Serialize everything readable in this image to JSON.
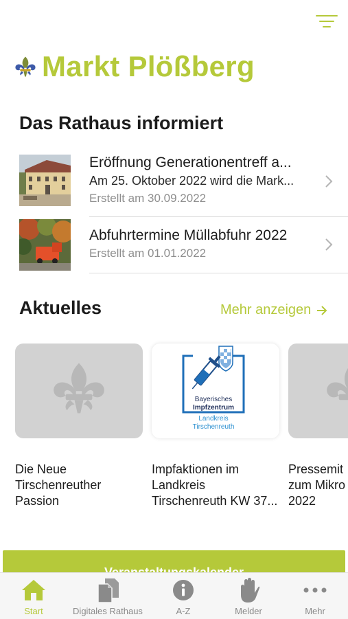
{
  "header": {
    "app_title": "Markt Plößberg",
    "filter_icon": "filter-icon",
    "accent_color": "#b5c93a"
  },
  "rathaus": {
    "title": "Das Rathaus informiert",
    "items": [
      {
        "title": "Eröffnung Generationentreff a...",
        "subtitle": "Am 25. Oktober 2022 wird die Mark...",
        "date": "Erstellt am 30.09.2022"
      },
      {
        "title": "Abfuhrtermine Müllabfuhr 2022",
        "date": "Erstellt am 01.01.2022"
      }
    ]
  },
  "aktuelles": {
    "title": "Aktuelles",
    "more_label": "Mehr anzeigen",
    "cards": [
      {
        "title": "Die Neue Tirschenreuther Passion"
      },
      {
        "title": "Impfaktionen im Landkreis Tirschenreuth KW 37...",
        "logo_lines": [
          "Bayerisches",
          "Impfzentrum",
          "Landkreis",
          "Tirschenreuth"
        ]
      },
      {
        "title": "Pressemit zum Mikro 2022"
      }
    ]
  },
  "cta": {
    "label": "Veranstaltungskalender"
  },
  "tabbar": {
    "tabs": [
      {
        "label": "Start",
        "icon": "home-icon",
        "active": true
      },
      {
        "label": "Digitales Rathaus",
        "icon": "documents-icon",
        "active": false
      },
      {
        "label": "A-Z",
        "icon": "info-icon",
        "active": false
      },
      {
        "label": "Melder",
        "icon": "hand-icon",
        "active": false
      },
      {
        "label": "Mehr",
        "icon": "more-icon",
        "active": false
      }
    ]
  }
}
